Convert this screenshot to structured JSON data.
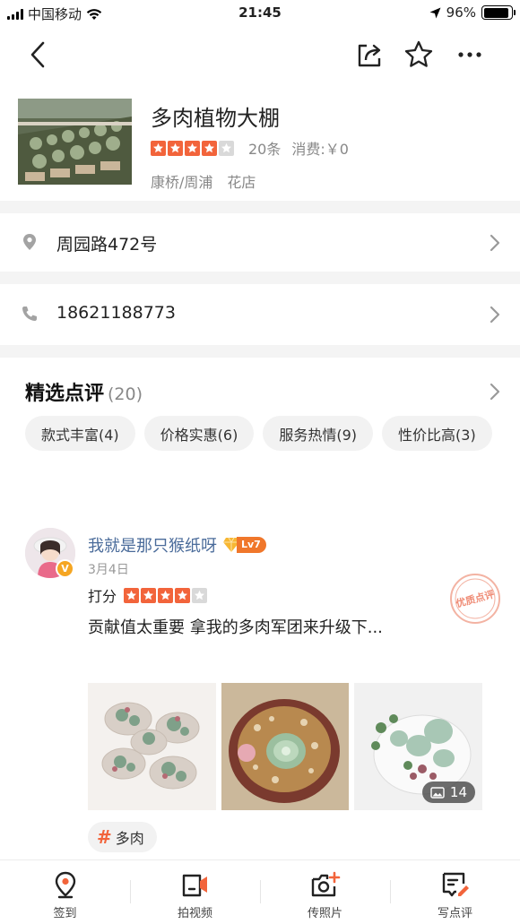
{
  "status_bar": {
    "carrier": "中国移动",
    "time": "21:45",
    "battery": "96%"
  },
  "nav": {
    "back_icon": "chevron-left-icon",
    "share_icon": "share-icon",
    "favorite_icon": "star-outline-icon",
    "more_icon": "ellipsis-icon"
  },
  "shop": {
    "name": "多肉植物大棚",
    "rating_stars": 4,
    "review_count": "20条",
    "consumption": "消费:￥0",
    "area": "康桥/周浦",
    "category": "花店"
  },
  "address": {
    "text": "周园路472号",
    "icon": "location-pin-icon"
  },
  "phone": {
    "text": "18621188773",
    "icon": "phone-icon"
  },
  "reviews": {
    "title": "精选点评",
    "count": "(20)",
    "tags": [
      "款式丰富(4)",
      "价格实惠(6)",
      "服务热情(9)",
      "性价比高(3)"
    ],
    "items": [
      {
        "user": "我就是那只猴纸呀",
        "verified_badge": "V",
        "level": "Lv7",
        "date": "3月4日",
        "score_label": "打分",
        "score_stars": 4,
        "text": "贡献值太重要 拿我的多肉军团来升级下...",
        "stamp": "优质点评",
        "photo_count": "14",
        "hashtag": "多肉"
      }
    ]
  },
  "tabbar": {
    "items": [
      {
        "label": "签到",
        "icon": "location-checkin-icon"
      },
      {
        "label": "拍视频",
        "icon": "video-icon"
      },
      {
        "label": "传照片",
        "icon": "camera-add-icon"
      },
      {
        "label": "写点评",
        "icon": "write-review-icon"
      }
    ]
  },
  "colors": {
    "accent": "#f2643b",
    "username": "#4a6b9a",
    "muted": "#888888"
  }
}
